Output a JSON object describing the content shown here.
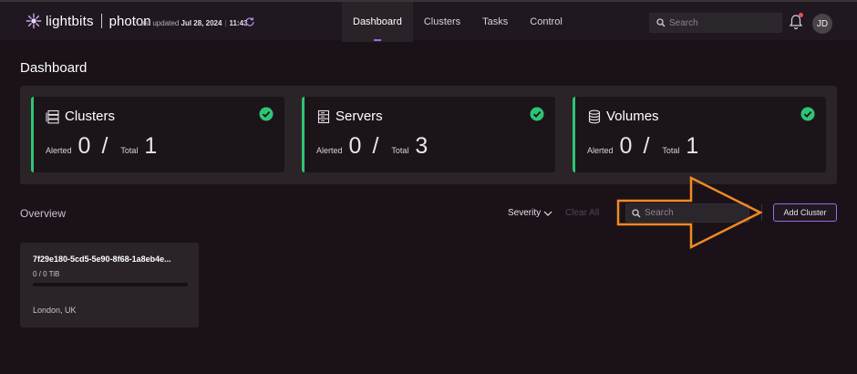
{
  "header": {
    "brand": "lightbits",
    "product": "photon",
    "last_updated_label": "Last updated",
    "last_updated_date": "Jul 28, 2024",
    "last_updated_time": "11:43",
    "search_placeholder": "Search",
    "avatar_initials": "JD",
    "nav": [
      {
        "label": "Dashboard",
        "active": true
      },
      {
        "label": "Clusters",
        "active": false
      },
      {
        "label": "Tasks",
        "active": false
      },
      {
        "label": "Control",
        "active": false
      }
    ]
  },
  "page": {
    "title": "Dashboard"
  },
  "stats": [
    {
      "icon": "cluster-icon",
      "title": "Clusters",
      "alerted_label": "Alerted",
      "alerted": "0",
      "total_label": "Total",
      "total": "1",
      "status": "ok"
    },
    {
      "icon": "server-icon",
      "title": "Servers",
      "alerted_label": "Alerted",
      "alerted": "0",
      "total_label": "Total",
      "total": "3",
      "status": "ok"
    },
    {
      "icon": "volume-icon",
      "title": "Volumes",
      "alerted_label": "Alerted",
      "alerted": "0",
      "total_label": "Total",
      "total": "1",
      "status": "ok"
    }
  ],
  "overview": {
    "label": "Overview",
    "severity_label": "Severity",
    "clear_all_label": "Clear All",
    "search_placeholder": "Search",
    "add_cluster_label": "Add Cluster"
  },
  "clusters": [
    {
      "id": "7f29e180-5cd5-5e90-8f68-1a8eb4e...",
      "capacity": "0 / 0 TiB",
      "usage_fraction": 0,
      "location": "London, UK"
    }
  ],
  "colors": {
    "accent": "#9b6ce0",
    "ok": "#2fc472",
    "annotation_arrow": "#f08a24",
    "background": "#1a1218"
  }
}
